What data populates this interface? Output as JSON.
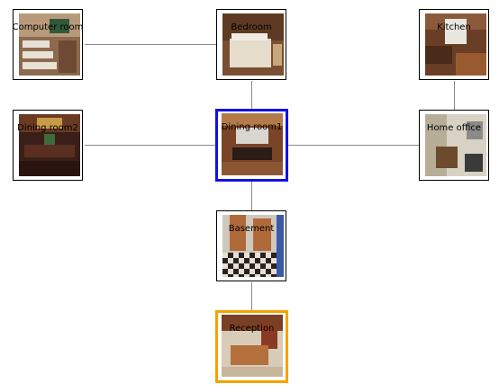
{
  "map": {
    "rooms": [
      {
        "id": "computer_room",
        "label": "Computer room",
        "state": "normal"
      },
      {
        "id": "bedroom",
        "label": "Bedroom",
        "state": "normal"
      },
      {
        "id": "kitchen",
        "label": "Kitchen",
        "state": "normal"
      },
      {
        "id": "dining_room2",
        "label": "Dining room2",
        "state": "normal"
      },
      {
        "id": "dining_room1",
        "label": "Dining room1",
        "state": "current"
      },
      {
        "id": "home_office",
        "label": "Home office",
        "state": "normal"
      },
      {
        "id": "basement",
        "label": "Basement",
        "state": "normal"
      },
      {
        "id": "reception",
        "label": "Reception",
        "state": "goal"
      }
    ],
    "connections": [
      [
        "computer_room",
        "bedroom"
      ],
      [
        "bedroom",
        "dining_room1"
      ],
      [
        "kitchen",
        "home_office"
      ],
      [
        "dining_room2",
        "dining_room1"
      ],
      [
        "dining_room1",
        "home_office"
      ],
      [
        "dining_room1",
        "basement"
      ],
      [
        "basement",
        "reception"
      ]
    ],
    "colors": {
      "current_border": "#1010e6",
      "goal_border": "#f5a300",
      "edge": "#8a8a8a"
    }
  }
}
